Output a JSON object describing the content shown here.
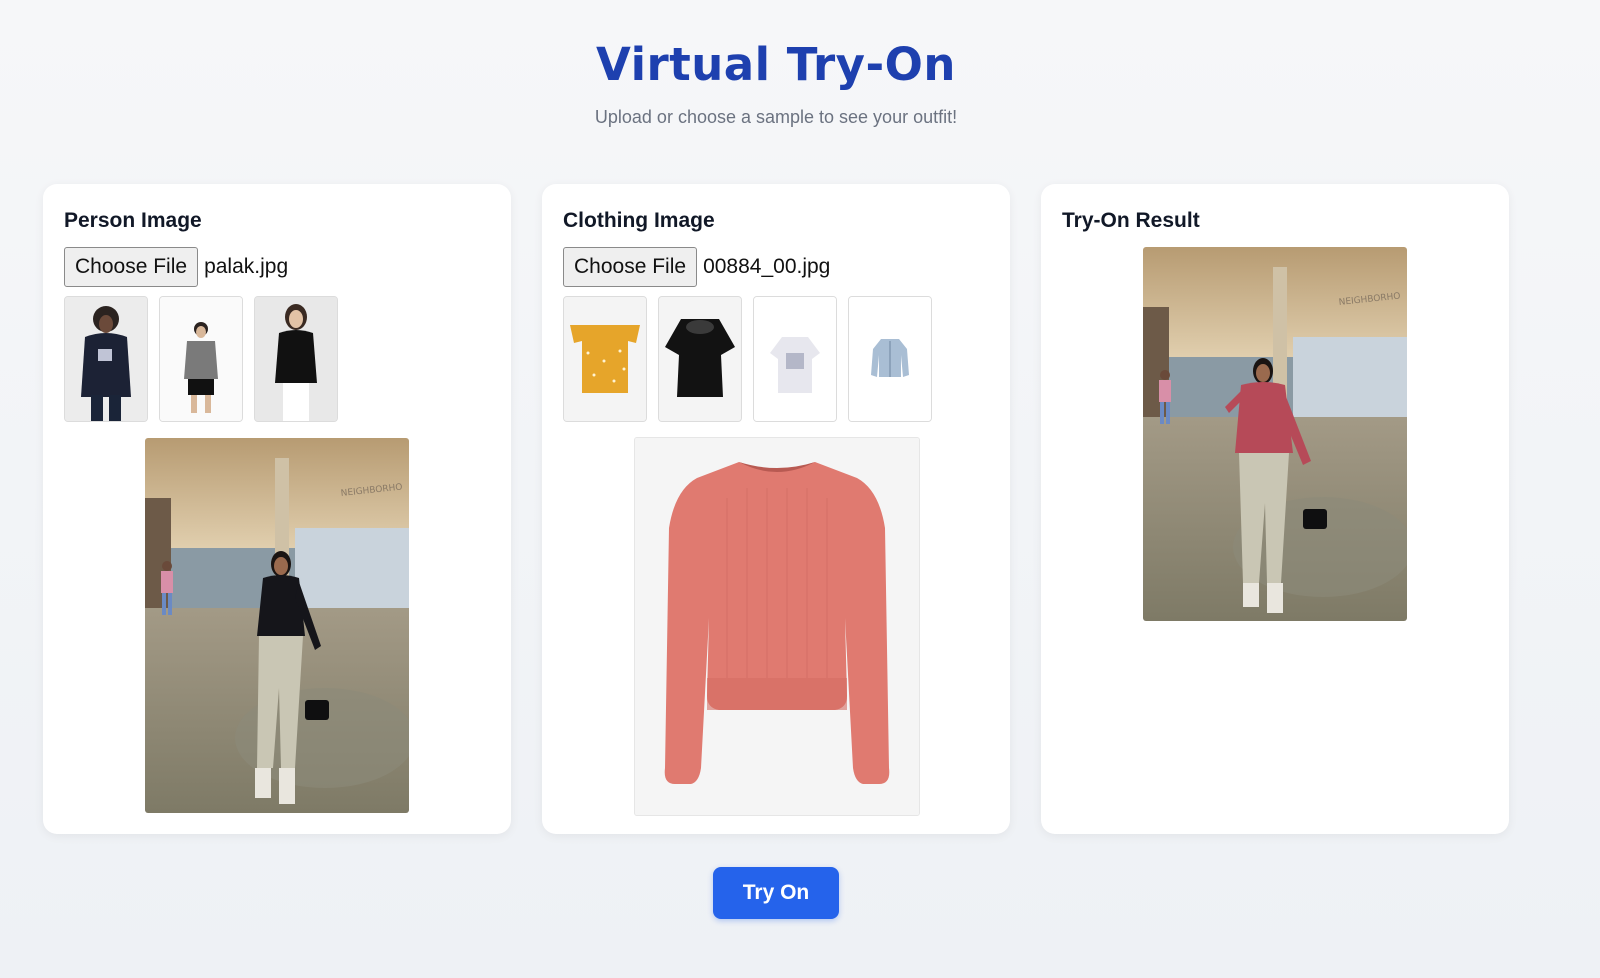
{
  "header": {
    "title": "Virtual Try-On",
    "subtitle": "Upload or choose a sample to see your outfit!"
  },
  "person_panel": {
    "title": "Person Image",
    "choose_label": "Choose File",
    "file_name": "palak.jpg",
    "samples": [
      "sample-person-1",
      "sample-person-2",
      "sample-person-3"
    ]
  },
  "clothing_panel": {
    "title": "Clothing Image",
    "choose_label": "Choose File",
    "file_name": "00884_00.jpg",
    "samples": [
      "sample-cloth-1",
      "sample-cloth-2",
      "sample-cloth-3",
      "sample-cloth-4"
    ]
  },
  "result_panel": {
    "title": "Try-On Result",
    "store_sign": "NEIGHBORHO"
  },
  "person_preview": {
    "store_sign": "NEIGHBORHO"
  },
  "actions": {
    "try_on_label": "Try On"
  },
  "colors": {
    "accent": "#2563eb",
    "title": "#1e40af",
    "sweater": "#e07a70"
  }
}
